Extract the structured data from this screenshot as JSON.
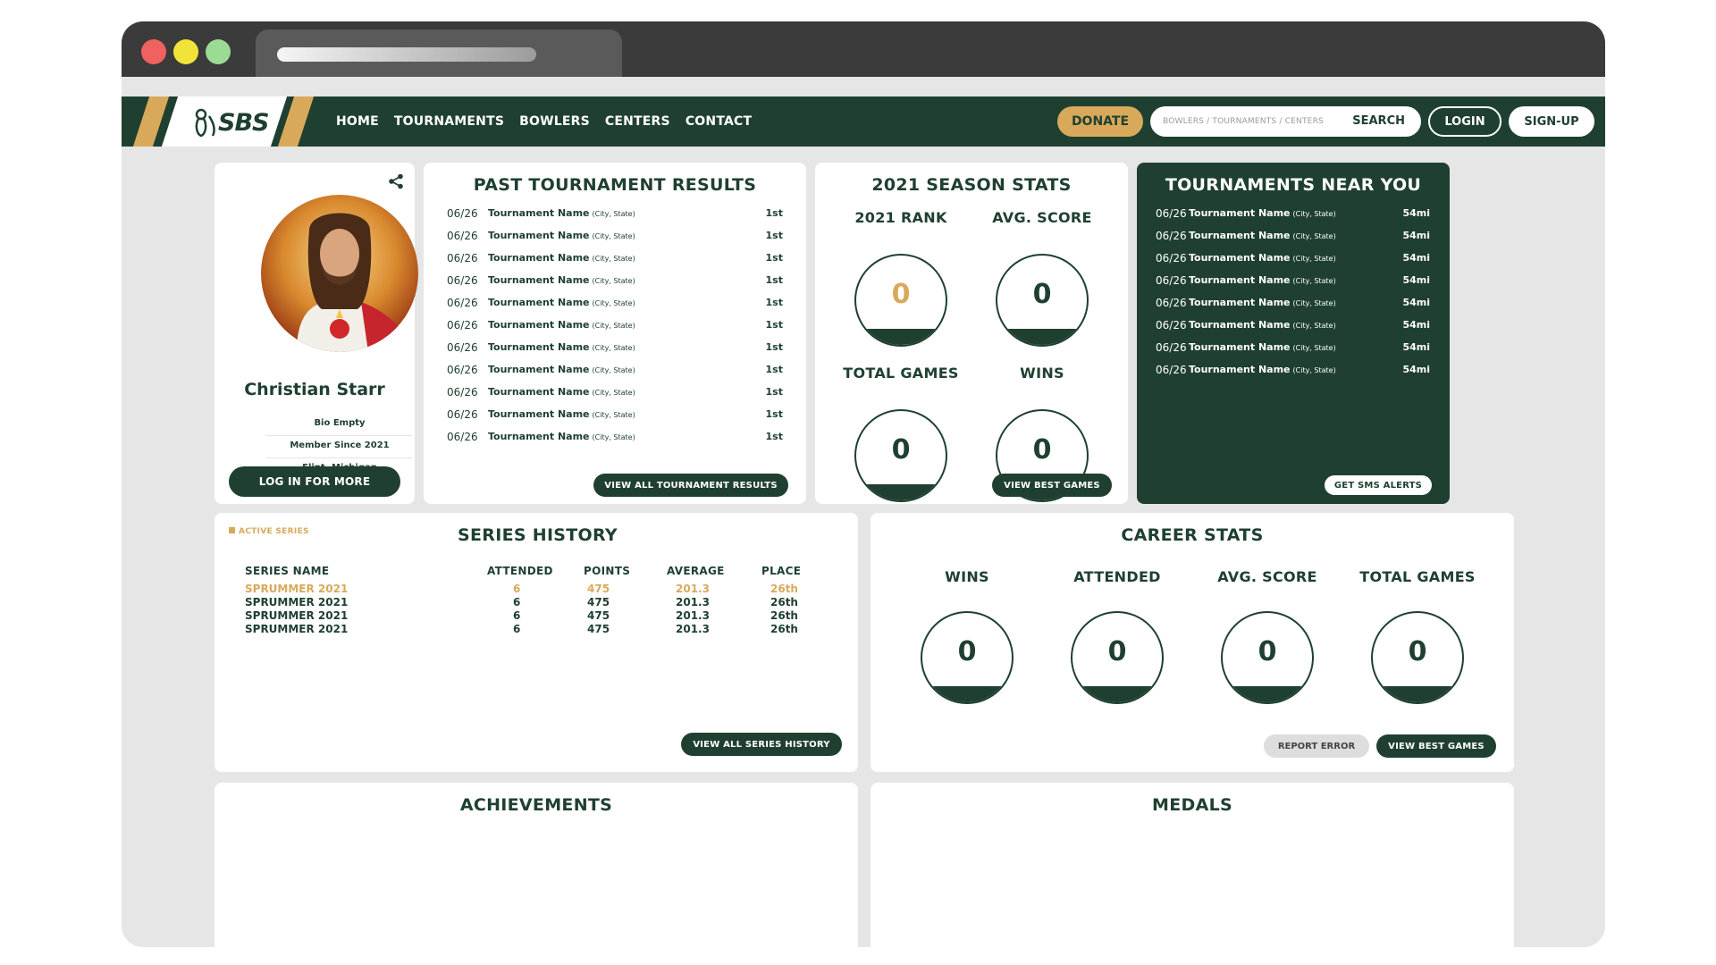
{
  "nav": {
    "logo": "SBS",
    "links": [
      "HOME",
      "TOURNAMENTS",
      "BOWLERS",
      "CENTERS",
      "CONTACT"
    ],
    "donate": "DONATE",
    "search_placeholder": "BOWLERS / TOURNAMENTS / CENTERS",
    "search_button": "SEARCH",
    "login": "LOGIN",
    "signup": "SIGN-UP"
  },
  "colors": {
    "primary": "#1f4030",
    "accent": "#d9a95b",
    "background": "#e6e6e6"
  },
  "profile": {
    "name": "Christian Starr",
    "bio": "Bio Empty",
    "member_since": "Member Since 2021",
    "location": "Flint, Michigan",
    "login_button": "LOG IN FOR MORE",
    "share_icon": "share-icon"
  },
  "past_results": {
    "title": "PAST TOURNAMENT RESULTS",
    "rows": [
      {
        "date": "06/26",
        "name": "Tournament Name",
        "loc": "(City, State)",
        "place": "1st"
      },
      {
        "date": "06/26",
        "name": "Tournament Name",
        "loc": "(City, State)",
        "place": "1st"
      },
      {
        "date": "06/26",
        "name": "Tournament Name",
        "loc": "(City, State)",
        "place": "1st"
      },
      {
        "date": "06/26",
        "name": "Tournament Name",
        "loc": "(City, State)",
        "place": "1st"
      },
      {
        "date": "06/26",
        "name": "Tournament Name",
        "loc": "(City, State)",
        "place": "1st"
      },
      {
        "date": "06/26",
        "name": "Tournament Name",
        "loc": "(City, State)",
        "place": "1st"
      },
      {
        "date": "06/26",
        "name": "Tournament Name",
        "loc": "(City, State)",
        "place": "1st"
      },
      {
        "date": "06/26",
        "name": "Tournament Name",
        "loc": "(City, State)",
        "place": "1st"
      },
      {
        "date": "06/26",
        "name": "Tournament Name",
        "loc": "(City, State)",
        "place": "1st"
      },
      {
        "date": "06/26",
        "name": "Tournament Name",
        "loc": "(City, State)",
        "place": "1st"
      },
      {
        "date": "06/26",
        "name": "Tournament Name",
        "loc": "(City, State)",
        "place": "1st"
      }
    ],
    "button": "VIEW ALL TOURNAMENT RESULTS"
  },
  "season": {
    "title": "2021 SEASON STATS",
    "stats": [
      {
        "label": "2021 RANK",
        "value": "0"
      },
      {
        "label": "AVG. SCORE",
        "value": "0"
      },
      {
        "label": "TOTAL GAMES",
        "value": "0"
      },
      {
        "label": "WINS",
        "value": "0"
      }
    ],
    "button": "VIEW BEST GAMES"
  },
  "nearby": {
    "title": "TOURNAMENTS NEAR YOU",
    "rows": [
      {
        "date": "06/26",
        "name": "Tournament Name",
        "loc": "(City, State)",
        "dist": "54mi"
      },
      {
        "date": "06/26",
        "name": "Tournament Name",
        "loc": "(City, State)",
        "dist": "54mi"
      },
      {
        "date": "06/26",
        "name": "Tournament Name",
        "loc": "(City, State)",
        "dist": "54mi"
      },
      {
        "date": "06/26",
        "name": "Tournament Name",
        "loc": "(City, State)",
        "dist": "54mi"
      },
      {
        "date": "06/26",
        "name": "Tournament Name",
        "loc": "(City, State)",
        "dist": "54mi"
      },
      {
        "date": "06/26",
        "name": "Tournament Name",
        "loc": "(City, State)",
        "dist": "54mi"
      },
      {
        "date": "06/26",
        "name": "Tournament Name",
        "loc": "(City, State)",
        "dist": "54mi"
      },
      {
        "date": "06/26",
        "name": "Tournament Name",
        "loc": "(City, State)",
        "dist": "54mi"
      }
    ],
    "button": "GET SMS ALERTS"
  },
  "series": {
    "tag": "ACTIVE SERIES",
    "title": "SERIES HISTORY",
    "headers": [
      "SERIES NAME",
      "ATTENDED",
      "POINTS",
      "AVERAGE",
      "PLACE"
    ],
    "rows": [
      {
        "name": "SPRUMMER 2021",
        "attended": "6",
        "points": "475",
        "average": "201.3",
        "place": "26th"
      },
      {
        "name": "SPRUMMER 2021",
        "attended": "6",
        "points": "475",
        "average": "201.3",
        "place": "26th"
      },
      {
        "name": "SPRUMMER 2021",
        "attended": "6",
        "points": "475",
        "average": "201.3",
        "place": "26th"
      },
      {
        "name": "SPRUMMER 2021",
        "attended": "6",
        "points": "475",
        "average": "201.3",
        "place": "26th"
      }
    ],
    "button": "VIEW ALL SERIES HISTORY"
  },
  "career": {
    "title": "CAREER STATS",
    "stats": [
      {
        "label": "WINS",
        "value": "0"
      },
      {
        "label": "ATTENDED",
        "value": "0"
      },
      {
        "label": "AVG. SCORE",
        "value": "0"
      },
      {
        "label": "TOTAL GAMES",
        "value": "0"
      }
    ],
    "report": "REPORT ERROR",
    "button": "VIEW BEST GAMES"
  },
  "achievements": {
    "title": "ACHIEVEMENTS"
  },
  "medals": {
    "title": "MEDALS"
  }
}
